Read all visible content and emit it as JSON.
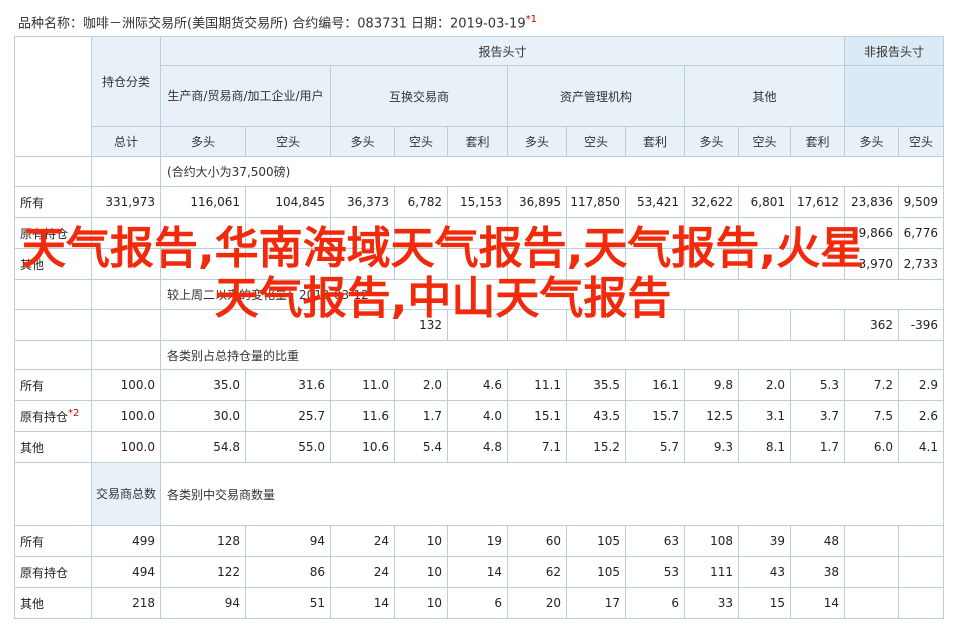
{
  "title": {
    "text": "品种名称：咖啡－洲际交易所(美国期货交易所)  合约编号：083731  日期：2019-03-19",
    "mark": "*1"
  },
  "headers": {
    "holding_category": "持仓分类",
    "report_header": "报告头寸",
    "non_report_header": "非报告头寸",
    "producer": "生产商/贸易商/加工企业/用户",
    "swap_dealer": "互换交易商",
    "managed_money": "资产管理机构",
    "other": "其他",
    "total": "总计",
    "long": "多头",
    "short": "空头",
    "spread": "套利"
  },
  "sections": {
    "contract_note": "(合约大小为37,500磅)",
    "change_note": "较上周二以来的变化量：2019-03-12",
    "pct_note": "各类别占总持仓量的比重",
    "trader_count_label": "交易商总数",
    "trader_count_note": "各类别中交易商数量"
  },
  "positions": [
    {
      "label": "所有",
      "mark": "",
      "values": [
        "331,973",
        "116,061",
        "104,845",
        "36,373",
        "6,782",
        "15,153",
        "36,895",
        "117,850",
        "53,421",
        "32,622",
        "6,801",
        "17,612",
        "23,836",
        "9,509"
      ]
    },
    {
      "label": "原有持仓",
      "mark": "",
      "values": [
        "",
        "",
        "",
        "",
        "",
        "",
        "",
        "",
        "",
        "",
        "",
        "",
        "19,866",
        "6,776"
      ]
    },
    {
      "label": "其他",
      "mark": "",
      "values": [
        "",
        "",
        "",
        "",
        "",
        "",
        "",
        "",
        "",
        "",
        "",
        "",
        "3,970",
        "2,733"
      ]
    }
  ],
  "changes": [
    {
      "label": "",
      "mark": "",
      "values": [
        "",
        "",
        "",
        "",
        "132",
        "",
        "",
        "",
        "",
        "",
        "",
        "",
        "362",
        "-396"
      ]
    }
  ],
  "percents": [
    {
      "label": "所有",
      "mark": "",
      "values": [
        "100.0",
        "35.0",
        "31.6",
        "11.0",
        "2.0",
        "4.6",
        "11.1",
        "35.5",
        "16.1",
        "9.8",
        "2.0",
        "5.3",
        "7.2",
        "2.9"
      ]
    },
    {
      "label": "原有持仓",
      "mark": "*2",
      "values": [
        "100.0",
        "30.0",
        "25.7",
        "11.6",
        "1.7",
        "4.0",
        "15.1",
        "43.5",
        "15.7",
        "12.5",
        "3.1",
        "3.7",
        "7.5",
        "2.6"
      ]
    },
    {
      "label": "其他",
      "mark": "",
      "values": [
        "100.0",
        "54.8",
        "55.0",
        "10.6",
        "5.4",
        "4.8",
        "7.1",
        "15.2",
        "5.7",
        "9.3",
        "8.1",
        "1.7",
        "6.0",
        "4.1"
      ]
    }
  ],
  "traders": [
    {
      "label": "所有",
      "mark": "",
      "values": [
        "499",
        "128",
        "94",
        "24",
        "10",
        "19",
        "60",
        "105",
        "63",
        "108",
        "39",
        "48",
        "",
        ""
      ]
    },
    {
      "label": "原有持仓",
      "mark": "",
      "values": [
        "494",
        "122",
        "86",
        "24",
        "10",
        "14",
        "62",
        "105",
        "53",
        "111",
        "43",
        "38",
        "",
        ""
      ]
    },
    {
      "label": "其他",
      "mark": "",
      "values": [
        "218",
        "94",
        "51",
        "14",
        "10",
        "6",
        "20",
        "17",
        "6",
        "33",
        "15",
        "14",
        "",
        ""
      ]
    }
  ],
  "overlay_text": "天气报告,华南海域天气报告,天气报告,火星天气报告,中山天气报告"
}
